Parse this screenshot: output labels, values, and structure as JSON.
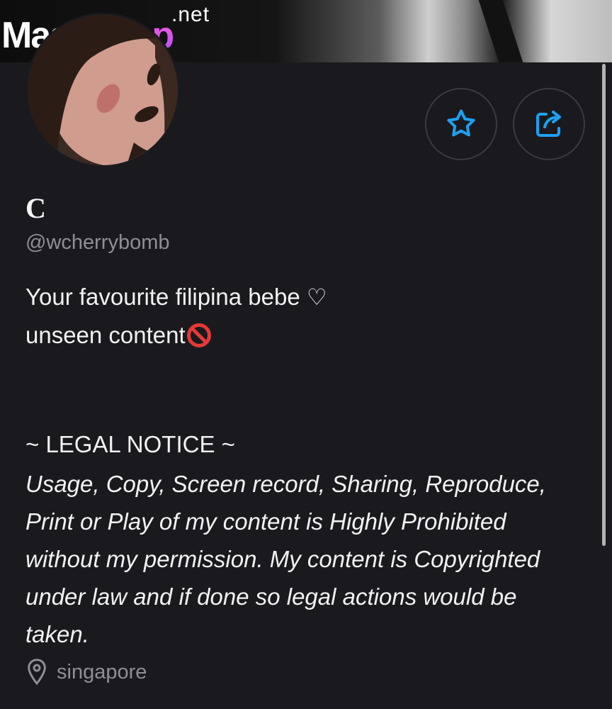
{
  "watermark": {
    "brand": "Master",
    "brand_accent": "Fap",
    "tld": ".net"
  },
  "profile": {
    "display_name": "C",
    "handle": "@wcherrybomb",
    "bio_line1": "Your favourite filipina bebe ",
    "bio_heart": "♡",
    "bio_line2": "unseen content",
    "notice_title": "~ LEGAL NOTICE ~",
    "notice_lines": [
      "Usage, Copy, Screen record, Sharing, Reproduce,",
      "Print or Play of my content is Highly Prohibited",
      "without my permission. My content is Copyrighted",
      "under law and if done so legal actions would be",
      "taken."
    ],
    "location": "singapore"
  },
  "icons": {
    "favorite": "star-icon",
    "share": "share-icon",
    "location": "map-pin-icon",
    "prohibited": "no-entry-icon"
  },
  "colors": {
    "background": "#1a1a1e",
    "accent": "#1da1f2",
    "muted_text": "#8e8e94",
    "prohibited_red": "#e53935"
  }
}
